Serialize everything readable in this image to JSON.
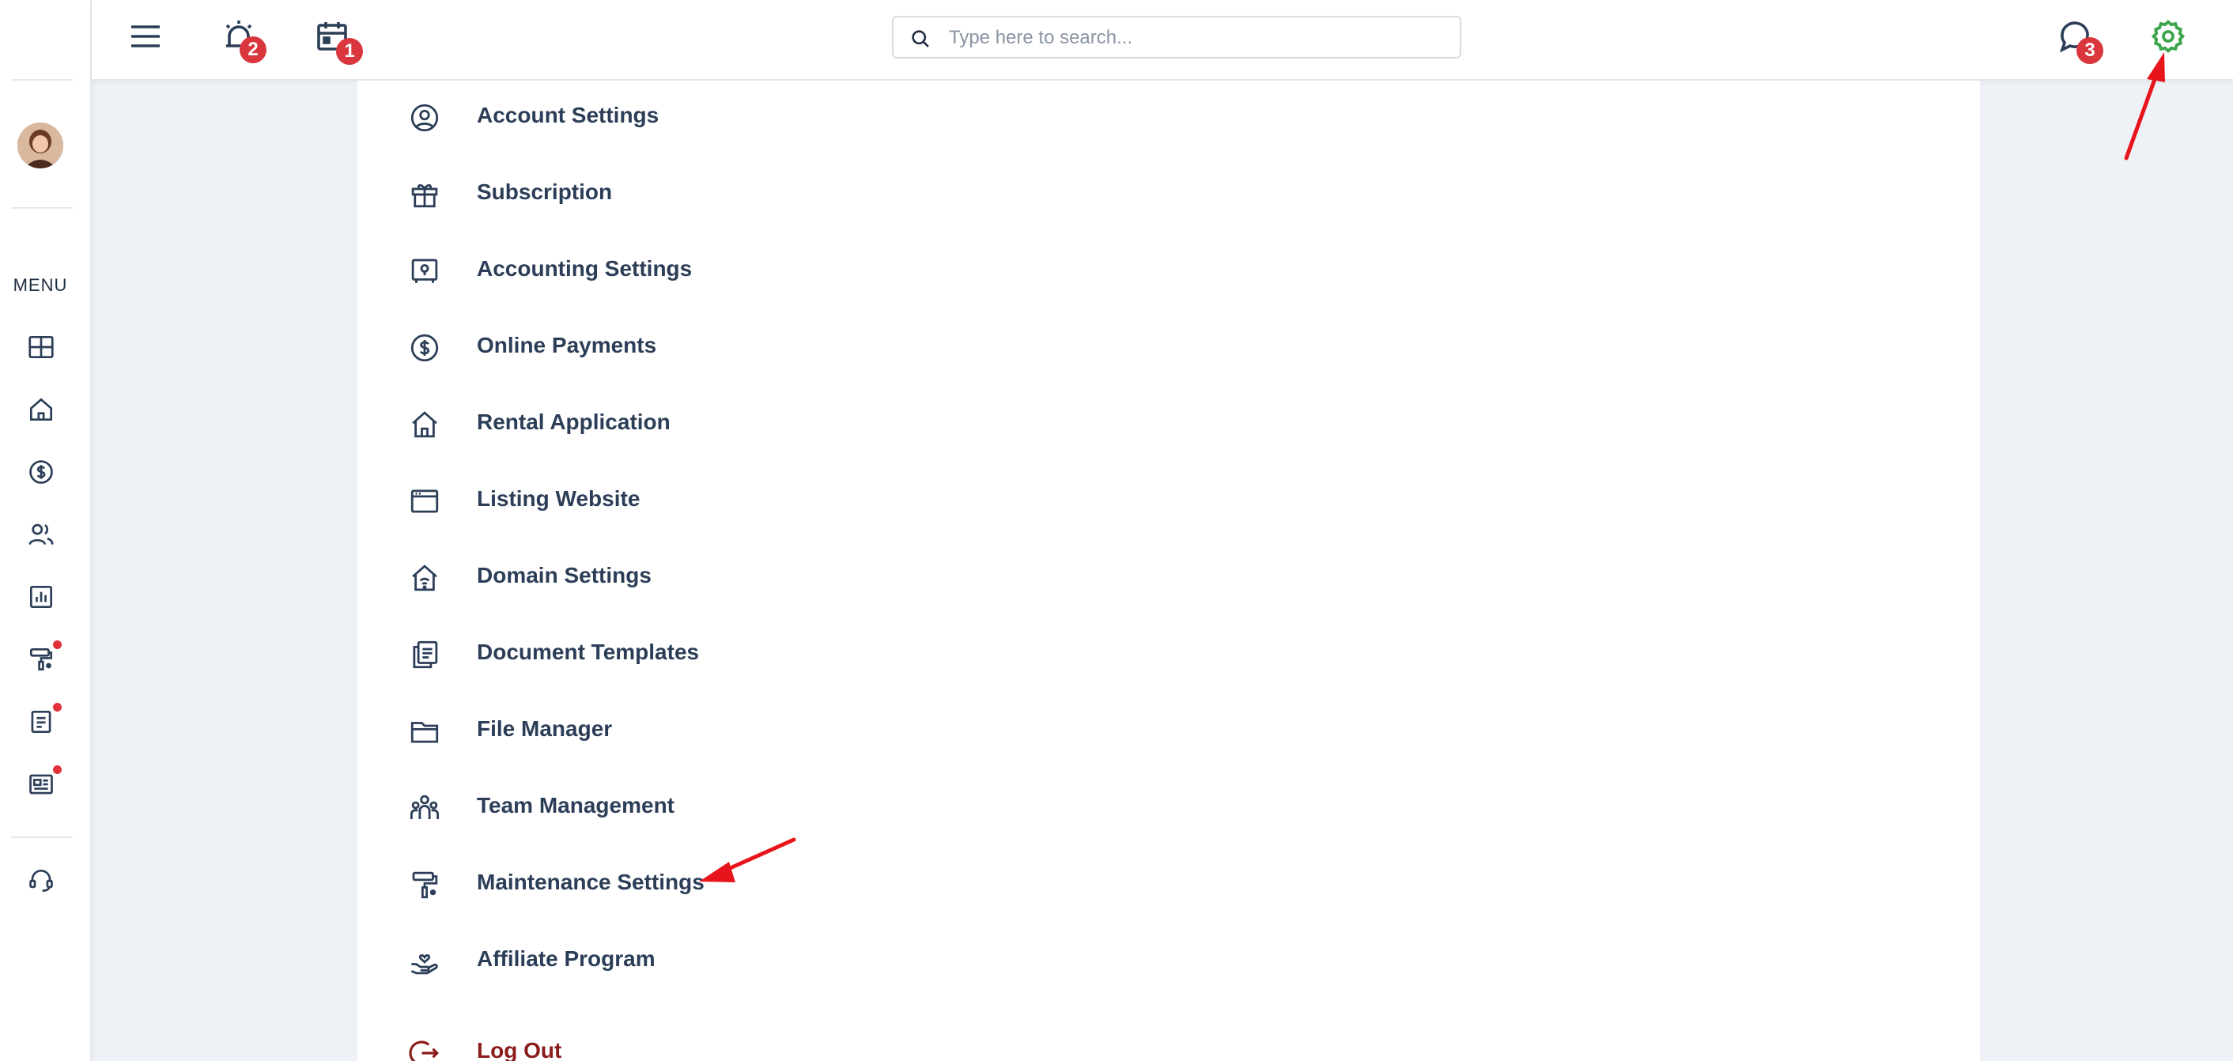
{
  "sidebar": {
    "menu_label": "MENU"
  },
  "topbar": {
    "alarm_badge": "2",
    "calendar_badge": "1",
    "chat_badge": "3",
    "search": {
      "placeholder": "Type here to search..."
    }
  },
  "settings_menu": {
    "items": [
      {
        "label": "Account Settings",
        "icon": "user-circle-icon"
      },
      {
        "label": "Subscription",
        "icon": "gift-icon"
      },
      {
        "label": "Accounting Settings",
        "icon": "safe-icon"
      },
      {
        "label": "Online Payments",
        "icon": "dollar-circle-icon"
      },
      {
        "label": "Rental Application",
        "icon": "house-icon"
      },
      {
        "label": "Listing Website",
        "icon": "browser-window-icon"
      },
      {
        "label": "Domain Settings",
        "icon": "house-signal-icon"
      },
      {
        "label": "Document Templates",
        "icon": "documents-icon"
      },
      {
        "label": "File Manager",
        "icon": "folder-icon"
      },
      {
        "label": "Team Management",
        "icon": "team-icon"
      },
      {
        "label": "Maintenance Settings",
        "icon": "paint-roller-icon"
      },
      {
        "label": "Affiliate Program",
        "icon": "hand-heart-icon"
      },
      {
        "label": "Log Out",
        "icon": "logout-icon"
      }
    ]
  },
  "colors": {
    "accent_green": "#3aa54a",
    "badge_red": "#d9363e",
    "logout_red": "#8b1c1c",
    "annotation_red": "#e8141b",
    "text_dark": "#2c3e57"
  }
}
